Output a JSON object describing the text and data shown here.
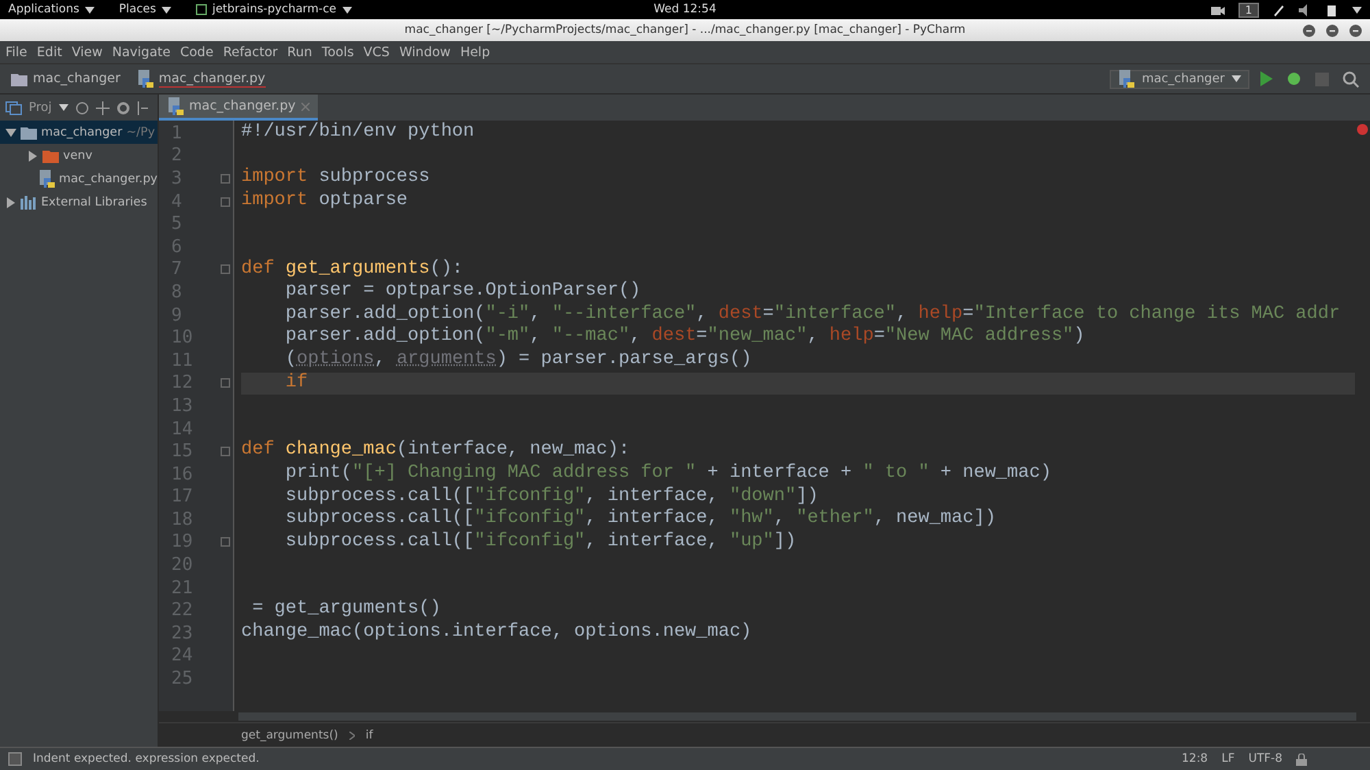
{
  "desktop_bar": {
    "menus": [
      "Applications",
      "Places",
      "jetbrains-pycharm-ce"
    ],
    "clock": "Wed 12:54",
    "workspace": "1"
  },
  "window": {
    "title": "mac_changer [~/PycharmProjects/mac_changer] - .../mac_changer.py [mac_changer] - PyCharm"
  },
  "menu": [
    "File",
    "Edit",
    "View",
    "Navigate",
    "Code",
    "Refactor",
    "Run",
    "Tools",
    "VCS",
    "Window",
    "Help"
  ],
  "navbar": {
    "breadcrumbs": [
      "mac_changer",
      "mac_changer.py"
    ],
    "run_config": "mac_changer"
  },
  "project": {
    "label": "Proj",
    "tree": [
      {
        "label": "mac_changer",
        "path": "~/Py",
        "kind": "folder",
        "expanded": true,
        "selected": true,
        "children": [
          {
            "label": "venv",
            "kind": "venv",
            "expanded": false,
            "selected": false
          },
          {
            "label": "mac_changer.py",
            "kind": "python",
            "selected": false
          }
        ]
      },
      {
        "label": "External Libraries",
        "kind": "library",
        "expanded": false,
        "selected": false
      }
    ]
  },
  "tabs": [
    {
      "label": "mac_changer.py",
      "selected": true
    }
  ],
  "editor": {
    "lines": [
      {
        "number": "1",
        "fold": false,
        "current": false,
        "tokens": [
          {
            "kind": "plain",
            "text": "#!/usr/bin/env python"
          }
        ]
      },
      {
        "number": "2",
        "fold": false,
        "current": false
      },
      {
        "number": "3",
        "fold": true,
        "current": false,
        "tokens": [
          {
            "kind": "kw",
            "text": "import"
          },
          {
            "kind": "plain",
            "text": " subprocess"
          }
        ]
      },
      {
        "number": "4",
        "fold": true,
        "current": false,
        "tokens": [
          {
            "kind": "kw",
            "text": "import"
          },
          {
            "kind": "plain",
            "text": " optparse"
          }
        ]
      },
      {
        "number": "5",
        "fold": false,
        "current": false
      },
      {
        "number": "6",
        "fold": false,
        "current": false
      },
      {
        "number": "7",
        "fold": true,
        "current": false,
        "tokens": [
          {
            "kind": "kw",
            "text": "def "
          },
          {
            "kind": "fn",
            "text": "get_arguments"
          },
          {
            "kind": "plain",
            "text": "():"
          }
        ]
      },
      {
        "number": "8",
        "fold": false,
        "current": false,
        "tokens": [
          {
            "kind": "plain",
            "text": "    parser = optparse.OptionParser()"
          }
        ]
      },
      {
        "number": "9",
        "fold": false,
        "current": false,
        "tokens": [
          {
            "kind": "plain",
            "text": "    parser.add_option("
          },
          {
            "kind": "str",
            "text": "\"-i\""
          },
          {
            "kind": "plain",
            "text": ", "
          },
          {
            "kind": "str",
            "text": "\"--interface\""
          },
          {
            "kind": "plain",
            "text": ", "
          },
          {
            "kind": "param",
            "text": "dest"
          },
          {
            "kind": "plain",
            "text": "="
          },
          {
            "kind": "str",
            "text": "\"interface\""
          },
          {
            "kind": "plain",
            "text": ", "
          },
          {
            "kind": "param",
            "text": "help"
          },
          {
            "kind": "plain",
            "text": "="
          },
          {
            "kind": "str",
            "text": "\"Interface to change its MAC addr"
          }
        ]
      },
      {
        "number": "10",
        "fold": false,
        "current": false,
        "tokens": [
          {
            "kind": "plain",
            "text": "    parser.add_option("
          },
          {
            "kind": "str",
            "text": "\"-m\""
          },
          {
            "kind": "plain",
            "text": ", "
          },
          {
            "kind": "str",
            "text": "\"--mac\""
          },
          {
            "kind": "plain",
            "text": ", "
          },
          {
            "kind": "param",
            "text": "dest"
          },
          {
            "kind": "plain",
            "text": "="
          },
          {
            "kind": "str",
            "text": "\"new_mac\""
          },
          {
            "kind": "plain",
            "text": ", "
          },
          {
            "kind": "param",
            "text": "help"
          },
          {
            "kind": "plain",
            "text": "="
          },
          {
            "kind": "str",
            "text": "\"New MAC address\""
          },
          {
            "kind": "plain",
            "text": ")"
          }
        ]
      },
      {
        "number": "11",
        "fold": false,
        "current": false,
        "tokens": [
          {
            "kind": "plain",
            "text": "    ("
          },
          {
            "kind": "unused",
            "text": "options"
          },
          {
            "kind": "plain",
            "text": ", "
          },
          {
            "kind": "unused",
            "text": "arguments"
          },
          {
            "kind": "plain",
            "text": ") = parser.parse_args()"
          }
        ]
      },
      {
        "number": "12",
        "fold": true,
        "current": true,
        "tokens": [
          {
            "kind": "kw",
            "text": "    if"
          }
        ]
      },
      {
        "number": "13",
        "fold": false,
        "current": false
      },
      {
        "number": "14",
        "fold": false,
        "current": false
      },
      {
        "number": "15",
        "fold": true,
        "current": false,
        "tokens": [
          {
            "kind": "kw",
            "text": "def "
          },
          {
            "kind": "fn",
            "text": "change_mac"
          },
          {
            "kind": "plain",
            "text": "(interface, new_mac):"
          }
        ]
      },
      {
        "number": "16",
        "fold": false,
        "current": false,
        "tokens": [
          {
            "kind": "plain",
            "text": "    print("
          },
          {
            "kind": "str",
            "text": "\"[+] Changing MAC address for \""
          },
          {
            "kind": "plain",
            "text": " + interface + "
          },
          {
            "kind": "str",
            "text": "\" to \""
          },
          {
            "kind": "plain",
            "text": " + new_mac)"
          }
        ]
      },
      {
        "number": "17",
        "fold": false,
        "current": false,
        "tokens": [
          {
            "kind": "plain",
            "text": "    subprocess.call(["
          },
          {
            "kind": "str",
            "text": "\"ifconfig\""
          },
          {
            "kind": "plain",
            "text": ", interface, "
          },
          {
            "kind": "str",
            "text": "\"down\""
          },
          {
            "kind": "plain",
            "text": "])"
          }
        ]
      },
      {
        "number": "18",
        "fold": false,
        "current": false,
        "tokens": [
          {
            "kind": "plain",
            "text": "    subprocess.call(["
          },
          {
            "kind": "str",
            "text": "\"ifconfig\""
          },
          {
            "kind": "plain",
            "text": ", interface, "
          },
          {
            "kind": "str",
            "text": "\"hw\""
          },
          {
            "kind": "plain",
            "text": ", "
          },
          {
            "kind": "str",
            "text": "\"ether\""
          },
          {
            "kind": "plain",
            "text": ", new_mac])"
          }
        ]
      },
      {
        "number": "19",
        "fold": true,
        "current": false,
        "tokens": [
          {
            "kind": "plain",
            "text": "    subprocess.call(["
          },
          {
            "kind": "str",
            "text": "\"ifconfig\""
          },
          {
            "kind": "plain",
            "text": ", interface, "
          },
          {
            "kind": "str",
            "text": "\"up\""
          },
          {
            "kind": "plain",
            "text": "])"
          }
        ]
      },
      {
        "number": "20",
        "fold": false,
        "current": false
      },
      {
        "number": "21",
        "fold": false,
        "current": false
      },
      {
        "number": "22",
        "fold": false,
        "current": false,
        "tokens": [
          {
            "kind": "plain",
            "text": " = get_arguments()"
          }
        ]
      },
      {
        "number": "23",
        "fold": false,
        "current": false,
        "tokens": [
          {
            "kind": "plain",
            "text": "change_mac(options.interface, options.new_mac)"
          }
        ]
      },
      {
        "number": "24",
        "fold": false,
        "current": false
      },
      {
        "number": "25",
        "fold": false,
        "current": false
      }
    ]
  },
  "breadcrumb": [
    "get_arguments()",
    "if"
  ],
  "status_bar": {
    "message": "Indent expected. expression expected.",
    "position": "12:8",
    "line_separator": "LF",
    "encoding": "UTF-8"
  }
}
